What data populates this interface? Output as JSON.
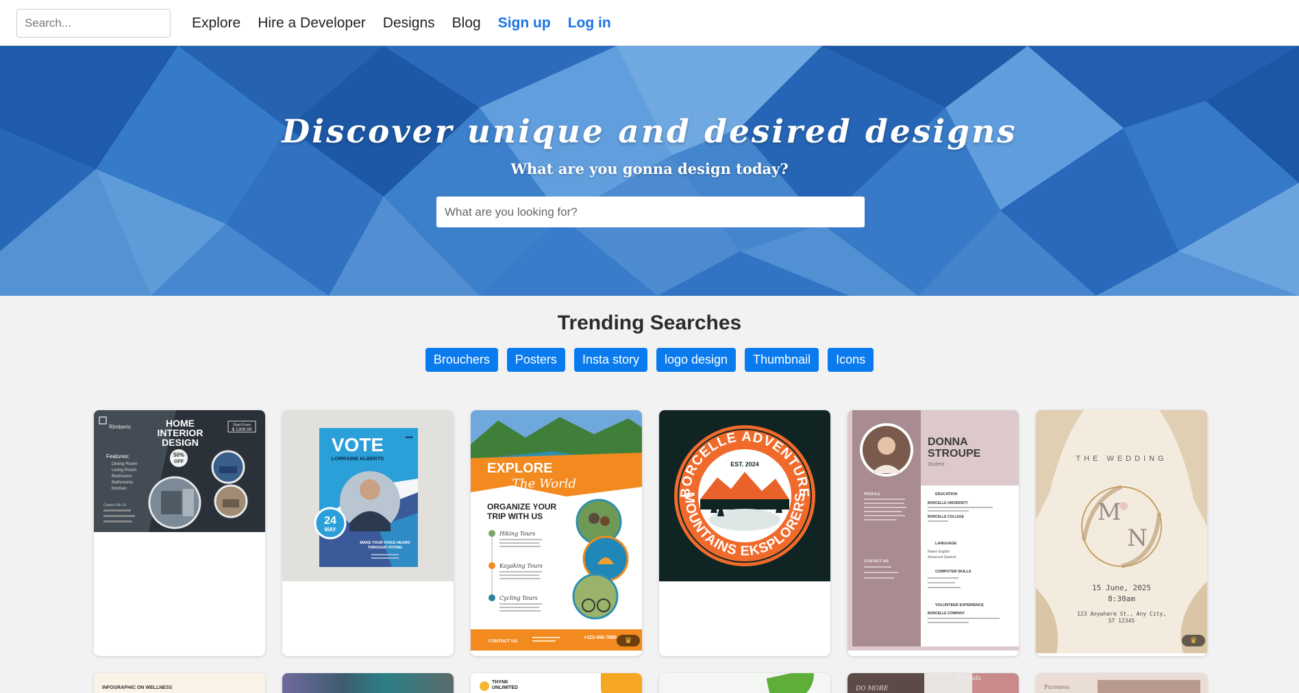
{
  "nav": {
    "search_placeholder": "Search...",
    "links": [
      "Explore",
      "Hire a Developer",
      "Designs",
      "Blog"
    ],
    "signup_label": "Sign up",
    "login_label": "Log in"
  },
  "hero": {
    "title": "Discover unique and desired designs",
    "subtitle": "What are you gonna design today?",
    "search_placeholder": "What are you looking for?"
  },
  "trending": {
    "title": "Trending Searches",
    "tags": [
      "Brouchers",
      "Posters",
      "Insta story",
      "logo design",
      "Thumbnail",
      "Icons"
    ]
  },
  "cards": [
    {
      "brand": "Rimberio",
      "title_line1": "HOME",
      "title_line2": "INTERIOR",
      "title_line3": "DESIGN",
      "price_label": "Start From",
      "price": "$ 1200.00",
      "discount_pct": "50%",
      "discount_word": "OFF",
      "features_title": "Features:",
      "features": [
        "Dining Room",
        "Living Room",
        "Bedrooms",
        "Bathrooms",
        "Kitchen"
      ],
      "contact_title": "Contact Me Us"
    },
    {
      "title": "VOTE",
      "name": "LORRAINE ALBERTS",
      "date_day": "24",
      "date_month": "MAY",
      "tagline_1": "MAKE YOUR VOICE HEARD",
      "tagline_2": "THROUGH VOTING"
    },
    {
      "title_1": "EXPLORE",
      "title_2": "The World",
      "subtitle_1": "ORGANIZE YOUR",
      "subtitle_2": "TRIP WITH US",
      "tours": [
        "Hiking Tours",
        "Kayaking Tours",
        "Cycling Tours"
      ],
      "footer_left": "CONTACT US",
      "footer_phone": "+123-456-7890",
      "premium_icon": "crown-icon"
    },
    {
      "top_text": "BORCELLE ADVENTURE",
      "bottom_text": "MOUNTAINS EKSPLORERS",
      "est": "EST. 2024"
    },
    {
      "name_1": "DONNA",
      "name_2": "STROUPE",
      "role": "Student",
      "left_sections": [
        "PROFILE",
        "CONTACT ME"
      ],
      "right_sections": [
        "EDUCATION",
        "LANGUAGE",
        "COMPUTER SKILLS",
        "VOLUNTEER EXPERIENCE"
      ],
      "education": [
        "BORCELLE UNIVERSITY",
        "BORCELLE COLLEGE"
      ],
      "languages": [
        "Native English",
        "Advanced Spanish"
      ],
      "volunteer": "BORCELLE COMPANY"
    },
    {
      "header": "THE WEDDING",
      "monogram_left": "M",
      "monogram_right": "N",
      "date": "15 June, 2025",
      "time": "8:30am",
      "address_1": "123 Anywhere St., Any City,",
      "address_2": "ST 12345",
      "premium_icon": "crown-icon"
    }
  ],
  "row2": {
    "card1_text": "INFOGRAPHIC ON WELLNESS",
    "card3_brand_1": "THYNK",
    "card3_brand_2": "UNLIMITED",
    "card5_text_1": "Friends",
    "card5_text_2": "DO MORE",
    "card6_text": "Pureness"
  },
  "colors": {
    "accent": "#1a73e8",
    "tag_bg": "#0a7bef",
    "hero_blue": "#2f74c5",
    "explore_orange": "#f28a1f",
    "borcelle_orange": "#f06a2b",
    "resume_mauve": "#a88c91"
  }
}
